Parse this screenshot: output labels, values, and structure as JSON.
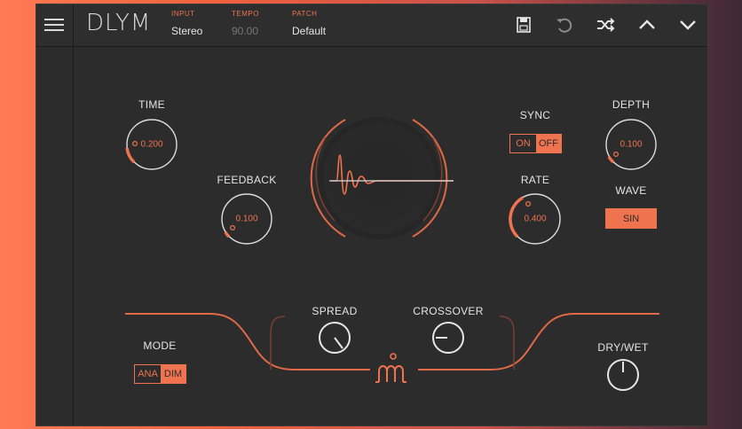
{
  "header": {
    "logo": "DLYM",
    "input": {
      "label": "INPUT",
      "value": "Stereo"
    },
    "tempo": {
      "label": "TEMPO",
      "value": "90.00"
    },
    "patch": {
      "label": "PATCH",
      "value": "Default"
    },
    "icons": [
      "menu-icon",
      "save-icon",
      "undo-icon",
      "shuffle-icon",
      "chevron-up-icon",
      "chevron-down-icon"
    ]
  },
  "controls": {
    "time": {
      "label": "TIME",
      "value": "0.200",
      "level": 0.2
    },
    "feedback": {
      "label": "FEEDBACK",
      "value": "0.100",
      "level": 0.1
    },
    "sync": {
      "label": "SYNC",
      "on": "ON",
      "off": "OFF",
      "selected": "OFF"
    },
    "rate": {
      "label": "RATE",
      "value": "0.400",
      "level": 0.4
    },
    "depth": {
      "label": "DEPTH",
      "value": "0.100",
      "level": 0.1
    },
    "wave": {
      "label": "WAVE",
      "value": "SIN"
    },
    "mode": {
      "label": "MODE",
      "ana": "ANA",
      "dim": "DIM",
      "selected": "DIM"
    },
    "spread": {
      "label": "SPREAD"
    },
    "crossover": {
      "label": "CROSSOVER"
    },
    "drywet": {
      "label": "DRY/WET"
    }
  },
  "colors": {
    "accent": "#f0734f",
    "panel": "#2c2c2c",
    "text": "#e4e4e4"
  }
}
